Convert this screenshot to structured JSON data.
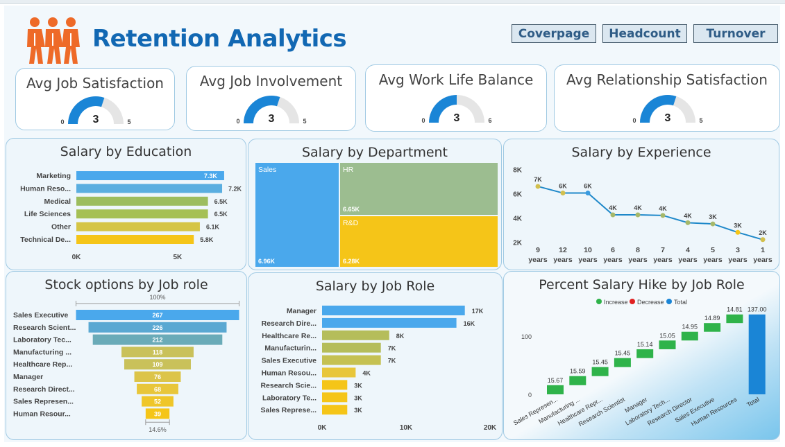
{
  "header": {
    "title": "Retention Analytics"
  },
  "nav": [
    {
      "label": "Coverpage"
    },
    {
      "label": "Headcount"
    },
    {
      "label": "Turnover"
    }
  ],
  "kpis": [
    {
      "title": "Avg Job Satisfaction",
      "value": "3",
      "min": "0",
      "max": "5",
      "fraction": 0.6
    },
    {
      "title": "Avg Job Involvement",
      "value": "3",
      "min": "0",
      "max": "5",
      "fraction": 0.6
    },
    {
      "title": "Avg Work Life Balance",
      "value": "3",
      "min": "0",
      "max": "6",
      "fraction": 0.5
    },
    {
      "title": "Avg Relationship Satisfaction",
      "value": "3",
      "min": "0",
      "max": "5",
      "fraction": 0.6
    }
  ],
  "colors": {
    "blue": "#4aa8ec",
    "green": "#9cbd5e",
    "yellow": "#f5c518",
    "gauge": "#1a85d6",
    "gauge_track": "#e5e5e5",
    "line": "#1e88c9",
    "increase": "#2fb34a",
    "decrease": "#e02020",
    "total": "#1a85d6",
    "teal": "#6aabb8"
  },
  "chart_data": [
    {
      "type": "bar",
      "orientation": "horizontal",
      "title": "Salary by Education",
      "categories": [
        "Marketing",
        "Human Reso...",
        "Medical",
        "Life Sciences",
        "Other",
        "Technical De..."
      ],
      "values": [
        7300,
        7200,
        6500,
        6500,
        6100,
        5800
      ],
      "labels": [
        "7.3K",
        "7.2K",
        "6.5K",
        "6.5K",
        "6.1K",
        "5.8K"
      ],
      "bar_colors": [
        "#4aa8ec",
        "#5aaee0",
        "#9cbd5e",
        "#a5c055",
        "#d5c546",
        "#f5c518"
      ],
      "xticks": [
        "0K",
        "5K"
      ],
      "xlim": [
        0,
        8500
      ]
    },
    {
      "type": "treemap",
      "title": "Salary by Department",
      "items": [
        {
          "label": "Sales",
          "value": "6.96K",
          "color": "#4aa8ec"
        },
        {
          "label": "HR",
          "value": "6.65K",
          "color": "#9cbd90"
        },
        {
          "label": "R&D",
          "value": "6.28K",
          "color": "#f5c518"
        }
      ]
    },
    {
      "type": "line",
      "title": "Salary by Experience",
      "x": [
        "9",
        "12",
        "10",
        "6",
        "8",
        "7",
        "4",
        "5",
        "3",
        "1"
      ],
      "x_unit": "years",
      "y": [
        6600,
        6050,
        6050,
        4250,
        4250,
        4200,
        3600,
        3500,
        2800,
        2200
      ],
      "labels": [
        "7K",
        "6K",
        "6K",
        "4K",
        "4K",
        "4K",
        "4K",
        "3K",
        "3K",
        "2K"
      ],
      "point_colors": [
        "#d2c04e",
        "#d2c04e",
        "#3a9be0",
        "#a5b86a",
        "#a5b86a",
        "#a5b86a",
        "#a5b86a",
        "#a5b86a",
        "#f5c518",
        "#d2c04e"
      ],
      "yticks": [
        "2K",
        "4K",
        "6K",
        "8K"
      ],
      "ylim": [
        1500,
        8200
      ]
    },
    {
      "type": "funnel",
      "title": "Stock options by Job role",
      "categories": [
        "Sales Executive",
        "Research Scient...",
        "Laboratory Tec...",
        "Manufacturing ...",
        "Healthcare Rep...",
        "Manager",
        "Research Direct...",
        "Sales Represen...",
        "Human Resour..."
      ],
      "values": [
        267,
        226,
        212,
        118,
        109,
        76,
        68,
        52,
        39
      ],
      "bar_colors": [
        "#4aa8ec",
        "#5aa8d2",
        "#6aabb8",
        "#c9c15a",
        "#c9c15a",
        "#dcc449",
        "#e8c63a",
        "#efc629",
        "#f5c518"
      ],
      "top_label": "100%",
      "bottom_label": "14.6%"
    },
    {
      "type": "bar",
      "orientation": "horizontal",
      "title": "Salary by Job Role",
      "categories": [
        "Manager",
        "Research Dire...",
        "Healthcare Re...",
        "Manufacturin...",
        "Sales Executive",
        "Human Resou...",
        "Research Scie...",
        "Laboratory Te...",
        "Sales Represe..."
      ],
      "values": [
        17000,
        16000,
        8000,
        7000,
        7000,
        4000,
        3000,
        3000,
        3000
      ],
      "labels": [
        "17K",
        "16K",
        "8K",
        "7K",
        "7K",
        "4K",
        "3K",
        "3K",
        "3K"
      ],
      "bar_colors": [
        "#4aa8ec",
        "#4aa8ec",
        "#b5bd5a",
        "#b5bd5a",
        "#c5c152",
        "#e8c63a",
        "#f5c518",
        "#f5c518",
        "#f5c518"
      ],
      "xticks": [
        "0K",
        "10K",
        "20K"
      ],
      "xlim": [
        0,
        20000
      ]
    },
    {
      "type": "waterfall",
      "title": "Percent Salary Hike by Job Role",
      "legend": [
        "Increase",
        "Decrease",
        "Total"
      ],
      "categories": [
        "Sales Represen...",
        "Manufacturing ...",
        "Healthcare Repr...",
        "Research Scientist",
        "Manager",
        "Laboratory Tech...",
        "Research Director",
        "Sales Executive",
        "Human Resources",
        "Total"
      ],
      "values": [
        15.67,
        15.59,
        15.45,
        15.45,
        15.14,
        15.05,
        14.95,
        14.89,
        14.81,
        137.0
      ],
      "labels": [
        "15.67",
        "15.59",
        "15.45",
        "15.45",
        "15.14",
        "15.05",
        "14.95",
        "14.89",
        "14.81",
        "137.00"
      ],
      "yticks": [
        "0",
        "100"
      ],
      "ylim": [
        0,
        145
      ]
    }
  ]
}
